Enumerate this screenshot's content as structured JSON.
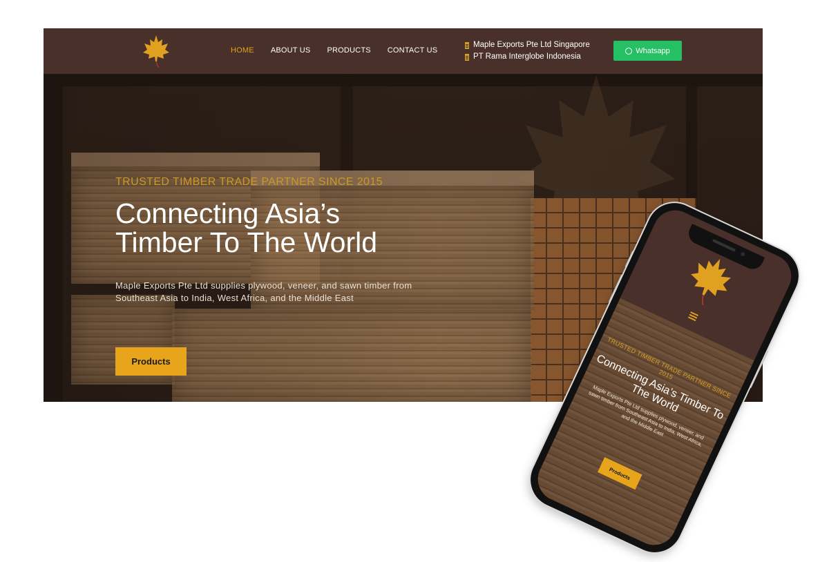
{
  "nav": {
    "items": [
      {
        "label": "HOME",
        "active": true
      },
      {
        "label": "ABOUT US",
        "active": false
      },
      {
        "label": "PRODUCTS",
        "active": false
      },
      {
        "label": "CONTACT US",
        "active": false
      }
    ],
    "companies": [
      "Maple Exports Pte Ltd Singapore",
      "PT Rama Interglobe Indonesia"
    ],
    "whatsapp_label": "Whatsapp"
  },
  "hero": {
    "tagline": "TRUSTED TIMBER TRADE PARTNER SINCE 2015",
    "title_line1": "Connecting Asia’s",
    "title_line2": "Timber To The World",
    "subtitle": "Maple Exports Pte Ltd supplies plywood, veneer, and sawn timber from Southeast Asia to India, West Africa, and the Middle East",
    "button_label": "Products"
  },
  "mobile": {
    "tagline": "TRUSTED TIMBER TRADE PARTNER SINCE 2015",
    "title": "Connecting Asia’s Timber To The World",
    "subtitle": "Maple Exports Pte Ltd supplies plywood, veneer, and sawn timber from Southeast Asia to India, West Africa, and the Middle East",
    "button_label": "Products"
  },
  "colors": {
    "nav_bg": "#4a302a",
    "accent_gold": "#e8a41a",
    "whatsapp_green": "#25c063",
    "active_menu": "#e0a020"
  },
  "icons": {
    "logo": "maple-leaf-icon",
    "company": "building-icon",
    "whatsapp": "whatsapp-icon",
    "menu": "hamburger-icon"
  }
}
